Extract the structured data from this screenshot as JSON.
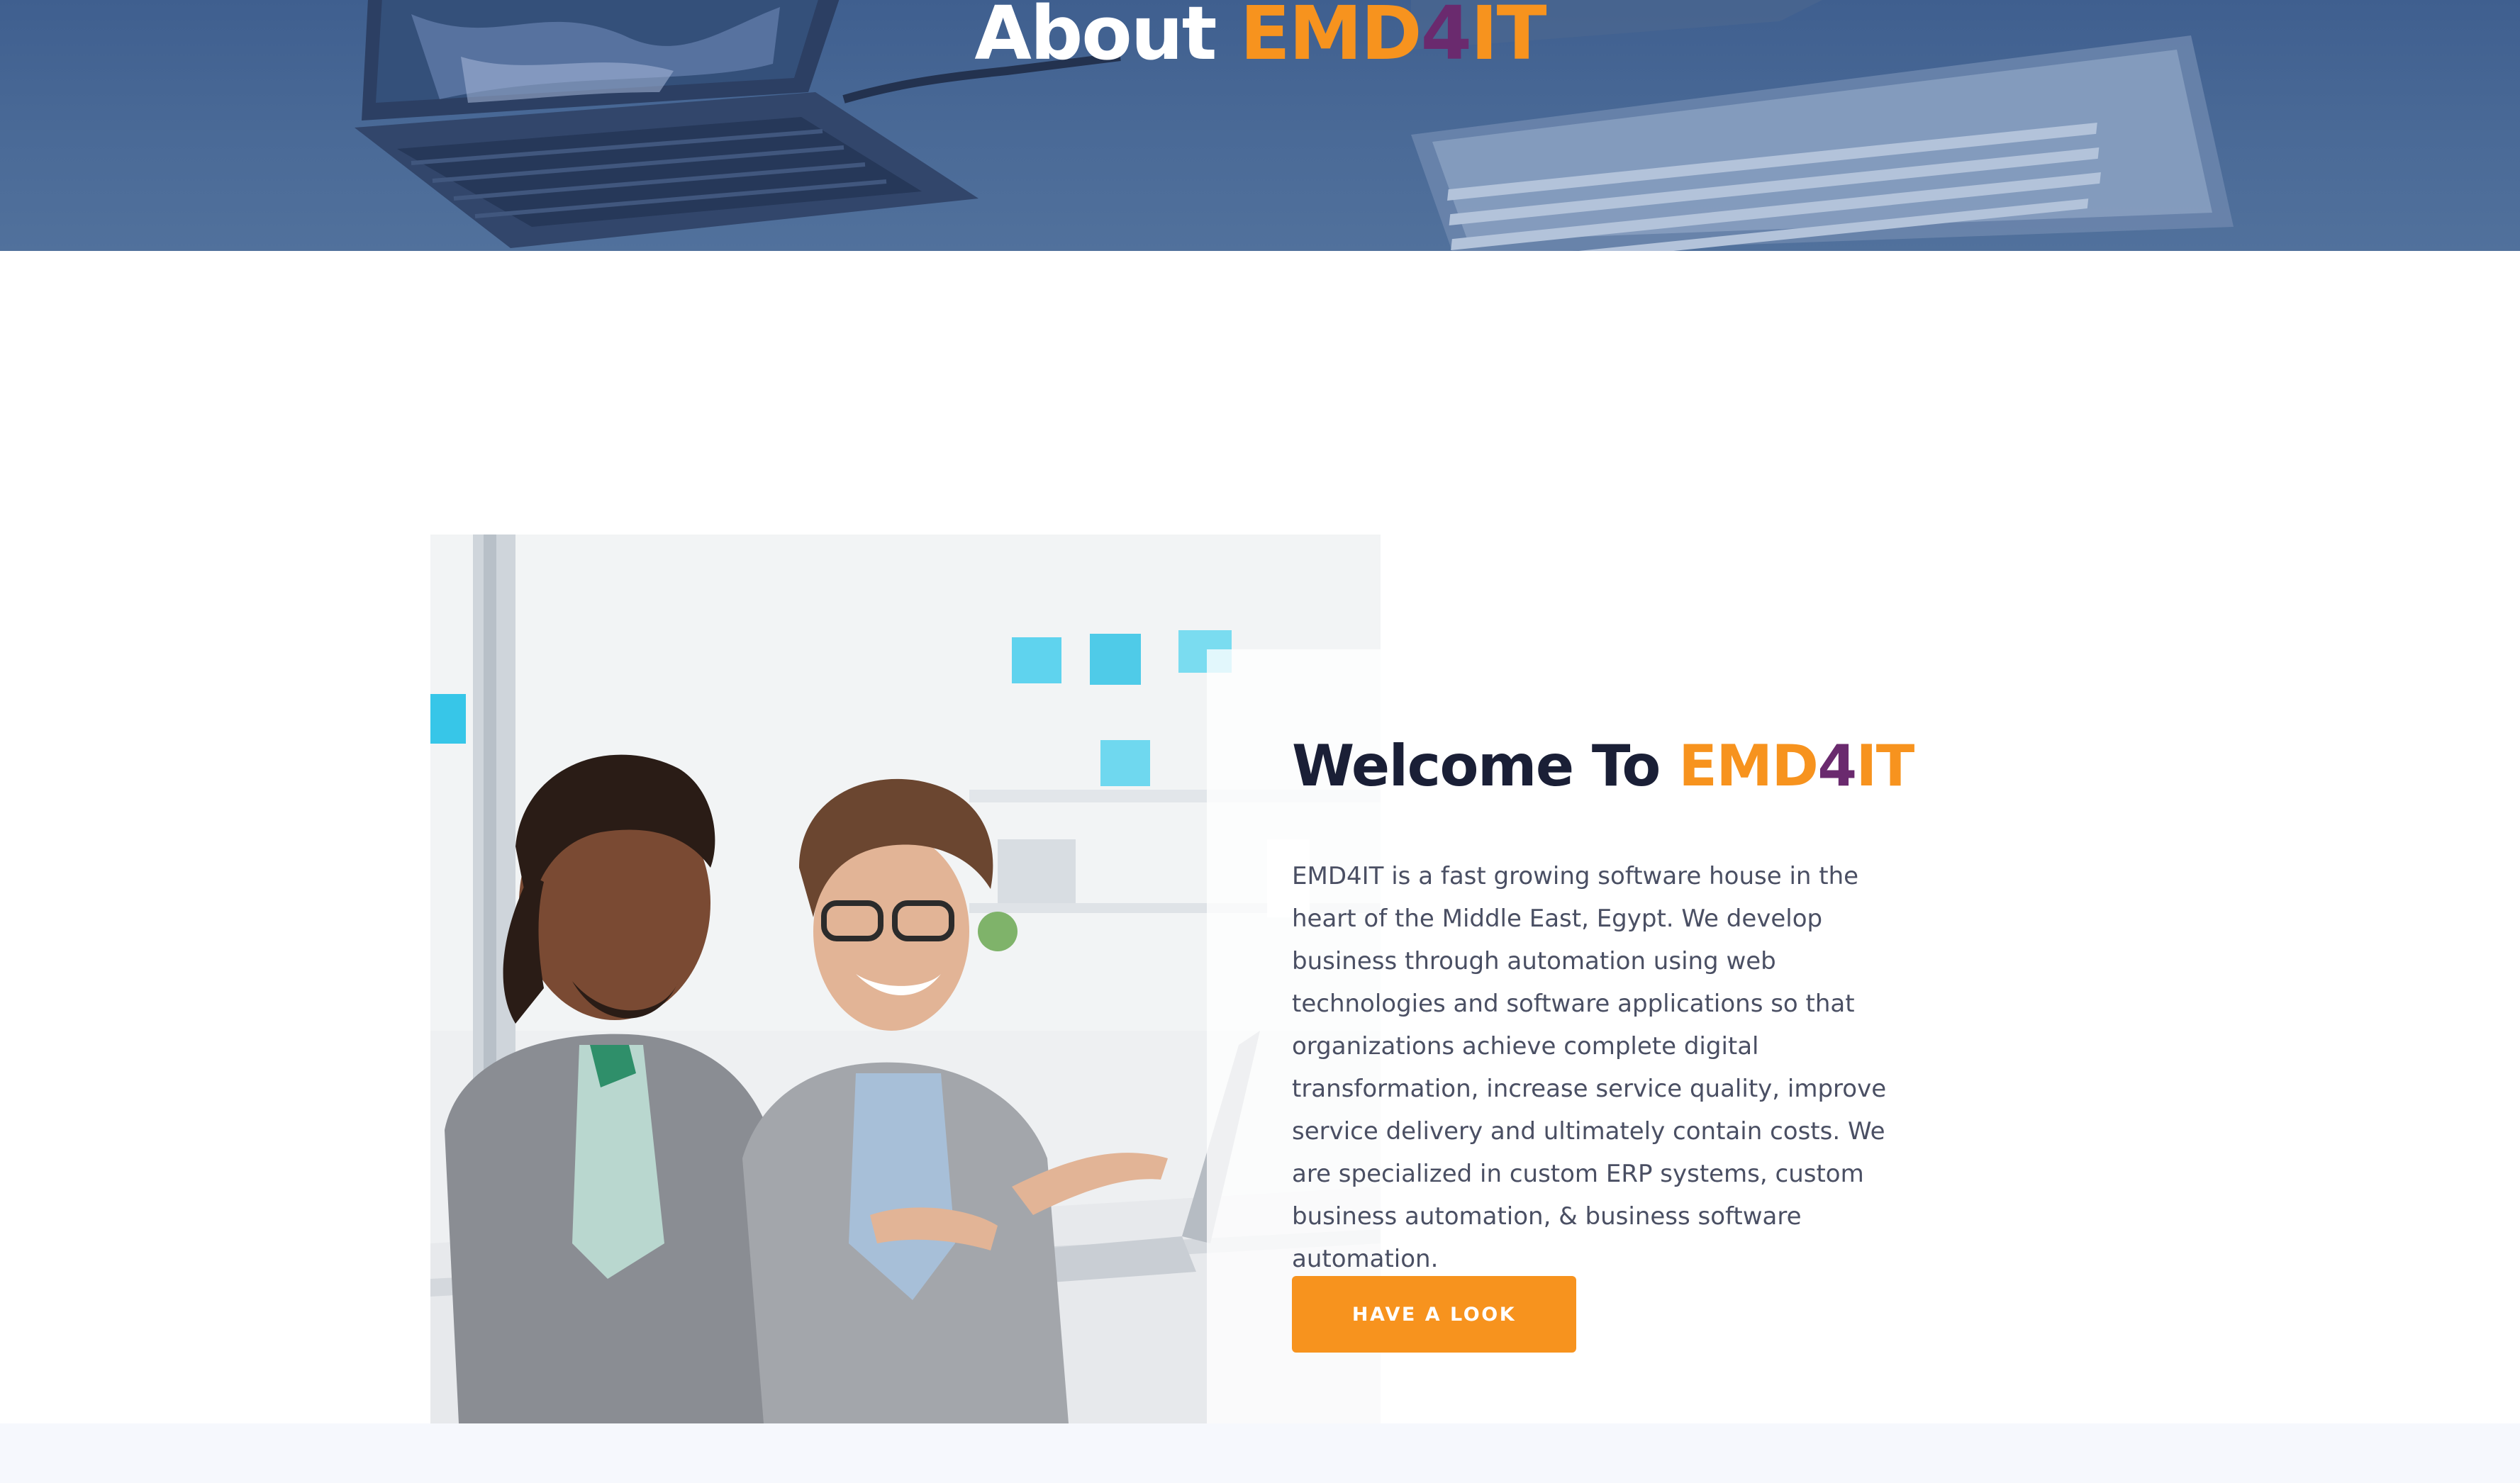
{
  "hero": {
    "title_prefix": "About ",
    "brand_part1": "EMD",
    "brand_part2": "4",
    "brand_part3": "IT"
  },
  "about": {
    "title_prefix": "Welcome To ",
    "brand_part1": "EMD",
    "brand_part2": "4",
    "brand_part3": "IT",
    "description": "EMD4IT is a fast growing software house in the heart of the Middle East, Egypt. We develop business through automation using web technologies and software applications so that organizations achieve complete digital transformation, increase service quality, improve service delivery and ultimately contain costs. We are specialized in custom ERP systems, custom business automation, & business software automation.",
    "button_label": "HAVE A LOOK"
  },
  "colors": {
    "brand_orange": "#f7931e",
    "brand_purple": "#6a2a6e",
    "heading_dark": "#1a1f36",
    "hero_overlay": "#4a6a97"
  },
  "icons": [
    "hero-laptop-image",
    "hero-keyboard-image",
    "team-photo-image"
  ]
}
